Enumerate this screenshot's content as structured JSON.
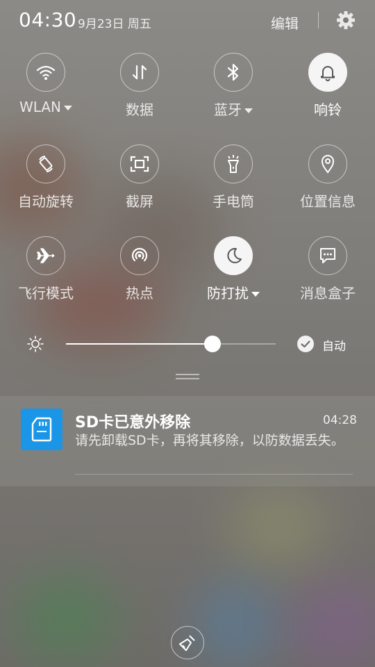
{
  "header": {
    "time": "04:30",
    "date": "9月23日 周五",
    "edit_label": "编辑",
    "settings_icon": "gear-icon"
  },
  "tiles": [
    {
      "label": "WLAN",
      "icon": "wifi-icon",
      "active": false,
      "dropdown": true
    },
    {
      "label": "数据",
      "icon": "mobile-data-icon",
      "active": false,
      "dropdown": false
    },
    {
      "label": "蓝牙",
      "icon": "bluetooth-icon",
      "active": false,
      "dropdown": true
    },
    {
      "label": "响铃",
      "icon": "bell-icon",
      "active": true,
      "dropdown": false
    },
    {
      "label": "自动旋转",
      "icon": "auto-rotate-icon",
      "active": false,
      "dropdown": false
    },
    {
      "label": "截屏",
      "icon": "screenshot-icon",
      "active": false,
      "dropdown": false
    },
    {
      "label": "手电筒",
      "icon": "flashlight-icon",
      "active": false,
      "dropdown": false
    },
    {
      "label": "位置信息",
      "icon": "location-icon",
      "active": false,
      "dropdown": false
    },
    {
      "label": "飞行模式",
      "icon": "airplane-icon",
      "active": false,
      "dropdown": false
    },
    {
      "label": "热点",
      "icon": "hotspot-icon",
      "active": false,
      "dropdown": false
    },
    {
      "label": "防打扰",
      "icon": "moon-icon",
      "active": true,
      "dropdown": true
    },
    {
      "label": "消息盒子",
      "icon": "message-box-icon",
      "active": false,
      "dropdown": false
    }
  ],
  "brightness": {
    "level": 0.7,
    "auto_label": "自动",
    "auto_checked": true
  },
  "notification": {
    "icon": "sd-card-icon",
    "title": "SD卡已意外移除",
    "time": "04:28",
    "text": "请先卸载SD卡，再将其移除，以防数据丢失。"
  },
  "colors": {
    "notification_icon_bg": "#1b96e6",
    "active_tile_bg": "#f5f5f5"
  }
}
